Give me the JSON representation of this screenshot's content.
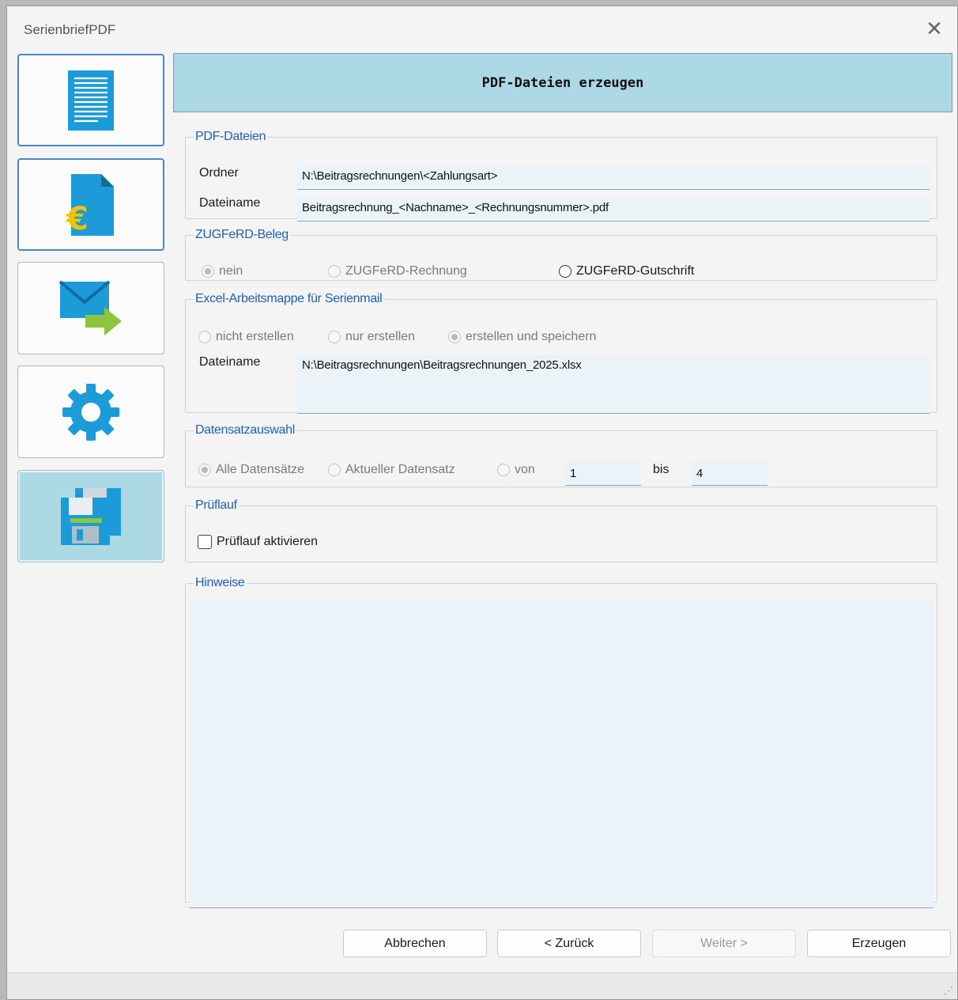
{
  "window": {
    "title": "SerienbriefPDF",
    "close_glyph": "✕"
  },
  "nav": [
    {
      "name": "document-icon",
      "state": "focus"
    },
    {
      "name": "euro-document-icon",
      "state": "focus"
    },
    {
      "name": "mail-forward-icon",
      "state": "normal"
    },
    {
      "name": "gear-icon",
      "state": "normal"
    },
    {
      "name": "floppy-disk-icon",
      "state": "active"
    }
  ],
  "header": {
    "title": "PDF-Dateien erzeugen"
  },
  "pdf_files": {
    "legend": "PDF-Dateien",
    "folder_label": "Ordner",
    "folder_value": "N:\\Beitragsrechnungen\\<Zahlungsart>",
    "filename_label": "Dateiname",
    "filename_value": "Beitragsrechnung_<Nachname>_<Rechnungsnummer>.pdf"
  },
  "zugferd": {
    "legend": "ZUGFeRD-Beleg",
    "options": [
      "nein",
      "ZUGFeRD-Rechnung",
      "ZUGFeRD-Gutschrift"
    ],
    "selected": "nein"
  },
  "excel": {
    "legend": "Excel-Arbeitsmappe für Serienmail",
    "options": [
      "nicht erstellen",
      "nur erstellen",
      "erstellen und speichern"
    ],
    "selected": "erstellen und speichern",
    "filename_label": "Dateiname",
    "filename_value": "N:\\Beitragsrechnungen\\Beitragsrechnungen_2025.xlsx"
  },
  "records": {
    "legend": "Datensatzauswahl",
    "options": [
      "Alle Datensätze",
      "Aktueller Datensatz",
      "von"
    ],
    "selected": "Alle Datensätze",
    "from_value": "1",
    "to_label": "bis",
    "to_value": "4"
  },
  "testrun": {
    "legend": "Prüflauf",
    "checkbox_label": "Prüflauf aktivieren",
    "checked": false
  },
  "notes": {
    "legend": "Hinweise",
    "value": ""
  },
  "buttons": {
    "cancel": "Abbrechen",
    "back": "< Zurück",
    "next": "Weiter >",
    "create": "Erzeugen"
  },
  "colors": {
    "header_bg": "#add8e6",
    "legend_text": "#1e5fb4",
    "field_bg": "#eaf3f8",
    "accent_blue": "#1d9bd8",
    "euro_yellow": "#f2c300",
    "arrow_green": "#8cc63f"
  }
}
